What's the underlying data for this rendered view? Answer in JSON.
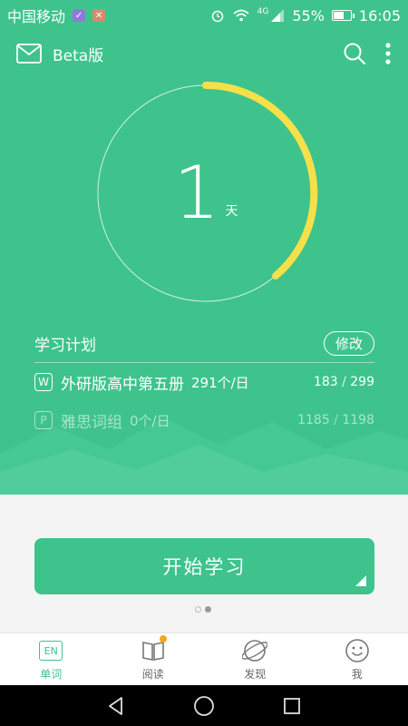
{
  "status_bar": {
    "carrier": "中国移动",
    "battery": "55%",
    "battery_level": 0.55,
    "network": "4G",
    "time": "16:05"
  },
  "header": {
    "title": "Beta版",
    "icons": [
      "mail-icon",
      "search-icon",
      "more-vertical-icon"
    ]
  },
  "progress": {
    "days": "1",
    "unit": "天"
  },
  "plan": {
    "title": "学习计划",
    "edit_label": "修改",
    "books": [
      {
        "tag": "W",
        "name": "外研版高中第五册",
        "rate": "291个/日",
        "done": "183",
        "sep": " / ",
        "total": "299"
      },
      {
        "tag": "P",
        "name": "雅思词组",
        "rate": "0个/日",
        "done": "1185",
        "sep": " / ",
        "total": "1198"
      }
    ]
  },
  "start_button": {
    "label": "开始学习"
  },
  "tabs": [
    {
      "label": "单词",
      "icon": "EN"
    },
    {
      "label": "阅读",
      "icon": "book-icon"
    },
    {
      "label": "发现",
      "icon": "planet-icon"
    },
    {
      "label": "我",
      "icon": "smiley-icon"
    }
  ],
  "colors": {
    "primary": "#3ec38c",
    "accent": "#f5e04a",
    "badge": "#f5a623"
  }
}
